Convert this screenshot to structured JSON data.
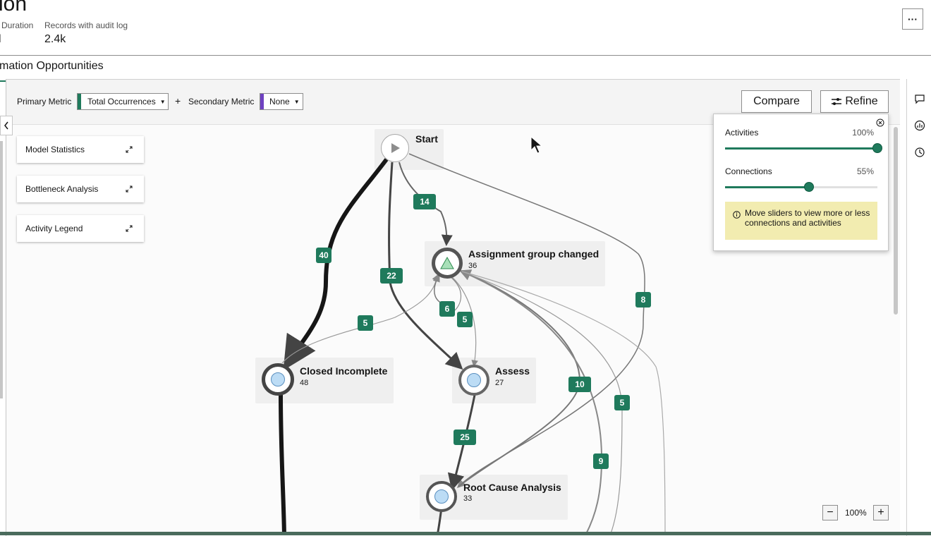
{
  "header": {
    "title": "ion",
    "stats": [
      {
        "label": "Duration",
        "value": "l"
      },
      {
        "label": "Records with audit log",
        "value": "2.4k"
      }
    ],
    "more_label": "···",
    "subtab": "mation Opportunities"
  },
  "toolbar": {
    "primary_label": "Primary Metric",
    "primary_value": "Total Occurrences",
    "secondary_plus": "+",
    "secondary_label": "Secondary Metric",
    "secondary_value": "None",
    "compare_label": "Compare",
    "refine_label": "Refine",
    "primary_color": "#1f7a5c",
    "secondary_color": "#6f42c1"
  },
  "side_cards": [
    {
      "label": "Model Statistics"
    },
    {
      "label": "Bottleneck Analysis"
    },
    {
      "label": "Activity Legend"
    }
  ],
  "nodes": {
    "start": {
      "label": "Start"
    },
    "assignment": {
      "label": "Assignment group changed",
      "count": "36"
    },
    "closed": {
      "label": "Closed Incomplete",
      "count": "48"
    },
    "assess": {
      "label": "Assess",
      "count": "27"
    },
    "rca": {
      "label": "Root Cause Analysis",
      "count": "33"
    }
  },
  "edges": [
    "40",
    "22",
    "14",
    "8",
    "5",
    "6",
    "5",
    "10",
    "5",
    "9",
    "25"
  ],
  "refine_panel": {
    "activities_label": "Activities",
    "activities_value": "100%",
    "activities_level": 1.0,
    "connections_label": "Connections",
    "connections_value": "55%",
    "connections_level": 0.55,
    "hint": "Move sliders to view more or less connections and activities"
  },
  "zoom": {
    "minus": "−",
    "level": "100%",
    "plus": "+"
  },
  "icons": [
    "chevron-left-icon",
    "expand-icon",
    "close-icon",
    "info-icon",
    "refine-sliders-icon",
    "chat-icon",
    "dashboard-icon",
    "history-icon",
    "play-icon",
    "triangle-icon",
    "circle-icon"
  ],
  "accent": "#1f7a5c",
  "hint_bg": "#f2ecb0"
}
